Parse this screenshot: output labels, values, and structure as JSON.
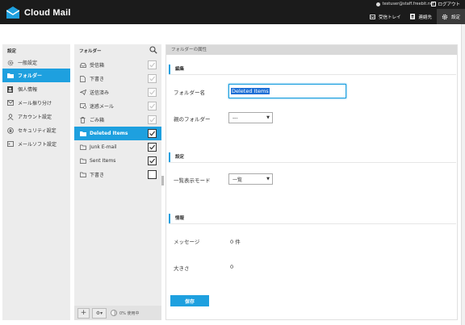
{
  "header": {
    "app_name": "Cloud Mail",
    "user_email": "testuser@staff.freebit.net",
    "logout": "ログアウト",
    "nav": [
      {
        "label": "受信トレイ",
        "icon": "inbox-icon"
      },
      {
        "label": "連絡先",
        "icon": "contacts-icon"
      },
      {
        "label": "設定",
        "icon": "gear-icon"
      }
    ]
  },
  "settings_nav": {
    "title": "設定",
    "items": [
      {
        "label": "一般設定",
        "icon": "gear-icon"
      },
      {
        "label": "フォルダー",
        "icon": "folder-icon"
      },
      {
        "label": "個人情報",
        "icon": "person-icon"
      },
      {
        "label": "メール振り分け",
        "icon": "filter-icon"
      },
      {
        "label": "アカウント設定",
        "icon": "account-icon"
      },
      {
        "label": "セキュリティ設定",
        "icon": "lock-icon"
      },
      {
        "label": "メールソフト設定",
        "icon": "mail-client-icon"
      }
    ]
  },
  "folders": {
    "title": "フォルダー",
    "items": [
      {
        "label": "受信箱",
        "icon": "inbox-icon",
        "subscribed": true,
        "locked": true
      },
      {
        "label": "下書き",
        "icon": "draft-icon",
        "subscribed": true,
        "locked": true
      },
      {
        "label": "送信済み",
        "icon": "sent-icon",
        "subscribed": true,
        "locked": true
      },
      {
        "label": "迷惑メール",
        "icon": "junk-icon",
        "subscribed": true,
        "locked": true
      },
      {
        "label": "ごみ箱",
        "icon": "trash-icon",
        "subscribed": true,
        "locked": true
      },
      {
        "label": "Deleted Items",
        "icon": "folder-icon",
        "subscribed": true,
        "locked": false
      },
      {
        "label": "Junk E-mail",
        "icon": "folder-icon",
        "subscribed": true,
        "locked": false
      },
      {
        "label": "Sent Items",
        "icon": "folder-icon",
        "subscribed": true,
        "locked": false
      },
      {
        "label": "下書き",
        "icon": "folder-icon",
        "subscribed": false,
        "locked": false
      }
    ],
    "footer": {
      "add": "+",
      "options": "⚙▾",
      "usage": "0% 使用中"
    }
  },
  "properties": {
    "header": "フォルダーの属性",
    "edit_section": "編集",
    "folder_name_label": "フォルダー名",
    "folder_name_value": "Deleted Items",
    "parent_label": "親のフォルダー",
    "parent_value": "---",
    "settings_section": "設定",
    "view_mode_label": "一覧表示モード",
    "view_mode_value": "一覧",
    "info_section": "情報",
    "messages_label": "メッセージ",
    "messages_value": "0 件",
    "size_label": "大きさ",
    "size_value": "0",
    "save_label": "保存"
  },
  "colors": {
    "accent": "#1ea0df",
    "header_bg": "#1b1b1b",
    "panel_bg": "#ececec"
  }
}
